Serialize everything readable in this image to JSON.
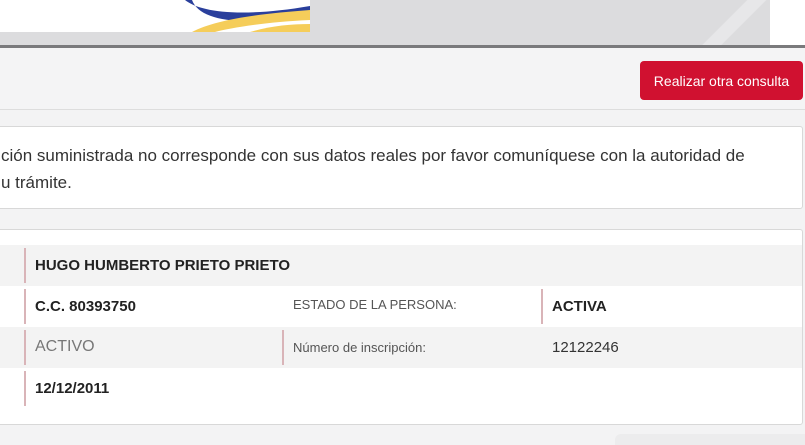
{
  "header": {
    "logo_icon": "colombia-flag-swoosh-icon",
    "colors": {
      "blue": "#2a3f9c",
      "yellow": "#f5cd5a",
      "bar": "#7a7a7c"
    }
  },
  "toolbar": {
    "new_query_label": "Realizar otra consulta",
    "button_color": "#d01130"
  },
  "notice": {
    "line1": "ción suministrada no corresponde con sus datos reales por favor comuníquese con la autoridad de",
    "line2": "u trámite."
  },
  "record": {
    "name": "HUGO HUMBERTO PRIETO PRIETO",
    "document": "C.C. 80393750",
    "person_status_label": "ESTADO DE LA PERSONA:",
    "person_status_value": "ACTIVA",
    "registration_status": "ACTIVO",
    "registration_number_label": "Número de inscripción:",
    "registration_number_value": "12122246",
    "date": "12/12/2011",
    "accent_color": "#d9b4b8"
  }
}
